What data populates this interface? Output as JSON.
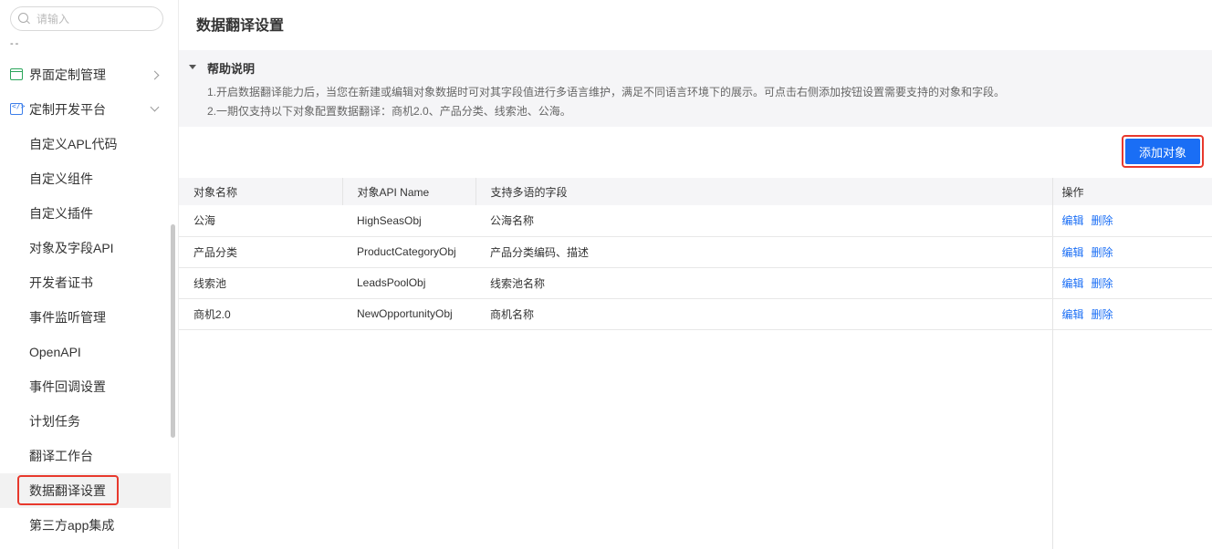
{
  "search": {
    "placeholder": "请输入"
  },
  "sidebar": {
    "dashes": "--",
    "groups": [
      {
        "label": "界面定制管理",
        "icon": "layout-icon",
        "expanded": false
      },
      {
        "label": "定制开发平台",
        "icon": "code-icon",
        "expanded": true
      }
    ],
    "items": [
      {
        "label": "自定义APL代码"
      },
      {
        "label": "自定义组件"
      },
      {
        "label": "自定义插件"
      },
      {
        "label": "对象及字段API"
      },
      {
        "label": "开发者证书"
      },
      {
        "label": "事件监听管理"
      },
      {
        "label": "OpenAPI"
      },
      {
        "label": "事件回调设置"
      },
      {
        "label": "计划任务"
      },
      {
        "label": "翻译工作台"
      },
      {
        "label": "数据翻译设置",
        "active": true
      },
      {
        "label": "第三方app集成"
      }
    ]
  },
  "page": {
    "title": "数据翻译设置",
    "help": {
      "title": "帮助说明",
      "line1": "1.开启数据翻译能力后，当您在新建或编辑对象数据时可对其字段值进行多语言维护，满足不同语言环境下的展示。可点击右侧添加按钮设置需要支持的对象和字段。",
      "line2": "2.一期仅支持以下对象配置数据翻译：商机2.0、产品分类、线索池、公海。"
    },
    "add_button": "添加对象"
  },
  "table": {
    "headers": [
      "对象名称",
      "对象API Name",
      "支持多语的字段",
      "操作"
    ],
    "rows": [
      {
        "name": "公海",
        "api": "HighSeasObj",
        "fields": "公海名称"
      },
      {
        "name": "产品分类",
        "api": "ProductCategoryObj",
        "fields": "产品分类编码、描述"
      },
      {
        "name": "线索池",
        "api": "LeadsPoolObj",
        "fields": "线索池名称"
      },
      {
        "name": "商机2.0",
        "api": "NewOpportunityObj",
        "fields": "商机名称"
      }
    ],
    "edit_label": "编辑",
    "delete_label": "删除"
  },
  "colors": {
    "accent": "#1a6ef5",
    "highlight": "#e8392d"
  }
}
